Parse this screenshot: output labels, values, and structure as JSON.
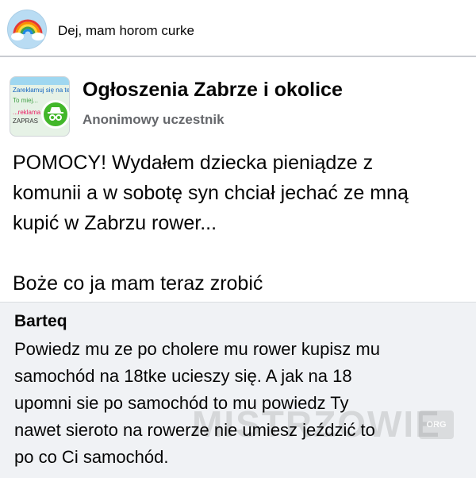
{
  "top_bar": {
    "name": "Dej, mam horom curke"
  },
  "group": {
    "name": "Ogłoszenia Zabrze i okolice",
    "author": "Anonimowy uczestnik",
    "thumbnail_lines": [
      "Zareklamuj się na tej",
      "To miej...",
      "...reklama",
      "ZAPRAS"
    ]
  },
  "post": {
    "lines": [
      "POMOCY! Wydałem dziecka pieniądze z",
      "komunii a w sobotę syn chciał jechać ze mną",
      "kupić w Zabrzu rower...",
      "Boże co ja mam teraz zrobić"
    ]
  },
  "comment": {
    "author": "Barteq",
    "lines": [
      "Powiedz mu ze po cholere mu rower kupisz mu",
      "samochód na 18tke ucieszy się. A jak na 18",
      "upomni sie po samochód to mu powiedz Ty",
      "nawet sieroto na rowerze nie umiesz jeździć to",
      "po co Ci samochód."
    ]
  },
  "watermark": {
    "text": "MISTRZOWIE",
    "badge": "ORG"
  },
  "icons": {
    "top_avatar": "rainbow-cloud-icon",
    "group_badge": "incognito-icon"
  },
  "colors": {
    "badge_green": "#42b72a",
    "muted_text": "#65676b",
    "comment_bg": "#f0f2f5",
    "avatar_bg": "#b9dcf3"
  }
}
